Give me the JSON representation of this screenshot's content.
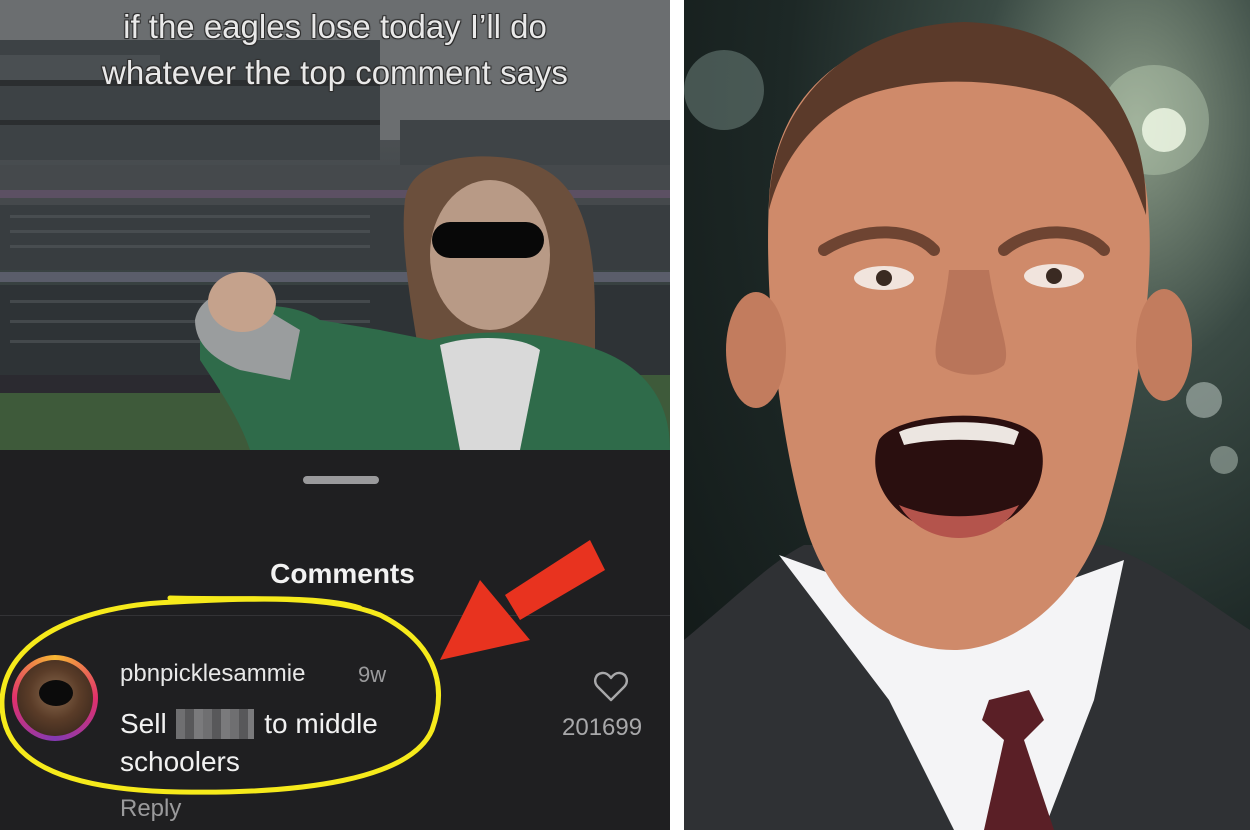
{
  "post": {
    "caption": "if the eagles lose today I’ll do whatever the top comment says"
  },
  "comments_sheet": {
    "title": "Comments"
  },
  "comment": {
    "username": "pbnpicklesammie",
    "time_ago": "9w",
    "text_before": "Sell",
    "text_after": "to middle schoolers",
    "reply_label": "Reply",
    "like_count": "201699"
  },
  "annotations": {
    "highlight_color": "#f6ea1b",
    "arrow_color": "#e8331f"
  },
  "icons": {
    "like": "heart-outline-icon",
    "avatar": "profile-avatar"
  }
}
